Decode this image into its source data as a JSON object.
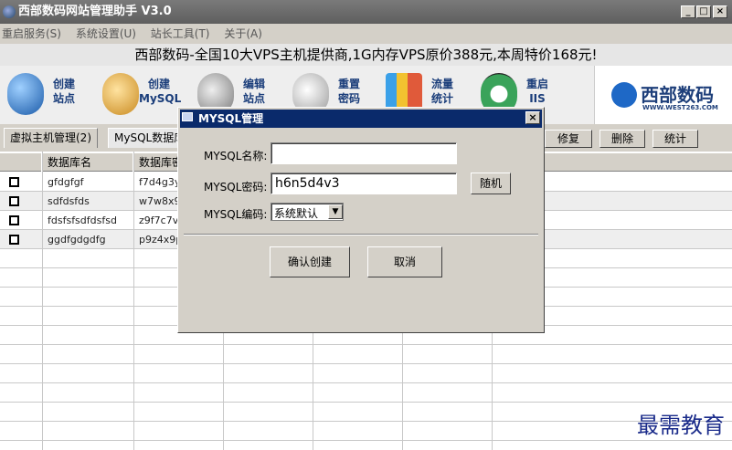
{
  "window": {
    "title": "西部数码网站管理助手 V3.0"
  },
  "menu": [
    "重启服务(S)",
    "系统设置(U)",
    "站长工具(T)",
    "关于(A)"
  ],
  "banner": "西部数码-全国10大VPS主机提供商,1G内存VPS原价388元,本周特价168元!",
  "toolbar": [
    {
      "label": "创建\n站点",
      "icon": "globe-icon",
      "color": "#2b6fc6"
    },
    {
      "label": "创建\nMySQL",
      "icon": "dolphin-icon",
      "color": "#d9a441"
    },
    {
      "label": "编辑\n站点",
      "icon": "tools-icon",
      "color": "#8a8a8a"
    },
    {
      "label": "重置\n密码",
      "icon": "keys-icon",
      "color": "#a0a0a0"
    },
    {
      "label": "流量\n统计",
      "icon": "bar-chart-icon",
      "color": "#3aa0e8"
    },
    {
      "label": "重启\nIIS",
      "icon": "restart-icon",
      "color": "#3aa35a"
    }
  ],
  "logo": {
    "name": "西部数码",
    "url": "WWW.WEST263.COM"
  },
  "tabs": [
    {
      "label": "虚拟主机管理(2)"
    },
    {
      "label": "MySQL数据库"
    }
  ],
  "actions": {
    "modify": "修复",
    "delete": "删除",
    "stats": "统计"
  },
  "table": {
    "columns": [
      "数据库名",
      "数据库密"
    ],
    "rows": [
      {
        "name": "gfdgfgf",
        "password": "f7d4g3y"
      },
      {
        "name": "sdfdsfds",
        "password": "w7w8x9"
      },
      {
        "name": "fdsfsfsdfdsfsd",
        "password": "z9f7c7v"
      },
      {
        "name": "ggdfgdgdfg",
        "password": "p9z4x9p"
      }
    ]
  },
  "dialog": {
    "title": "MYSQL管理",
    "name_label": "MYSQL名称:",
    "name_value": "",
    "password_label": "MYSQL密码:",
    "password_value": "h6n5d4v3",
    "random_label": "随机",
    "encoding_label": "MYSQL编码:",
    "encoding_value": "系统默认",
    "confirm_label": "确认创建",
    "cancel_label": "取消"
  },
  "watermark": "最需教育"
}
